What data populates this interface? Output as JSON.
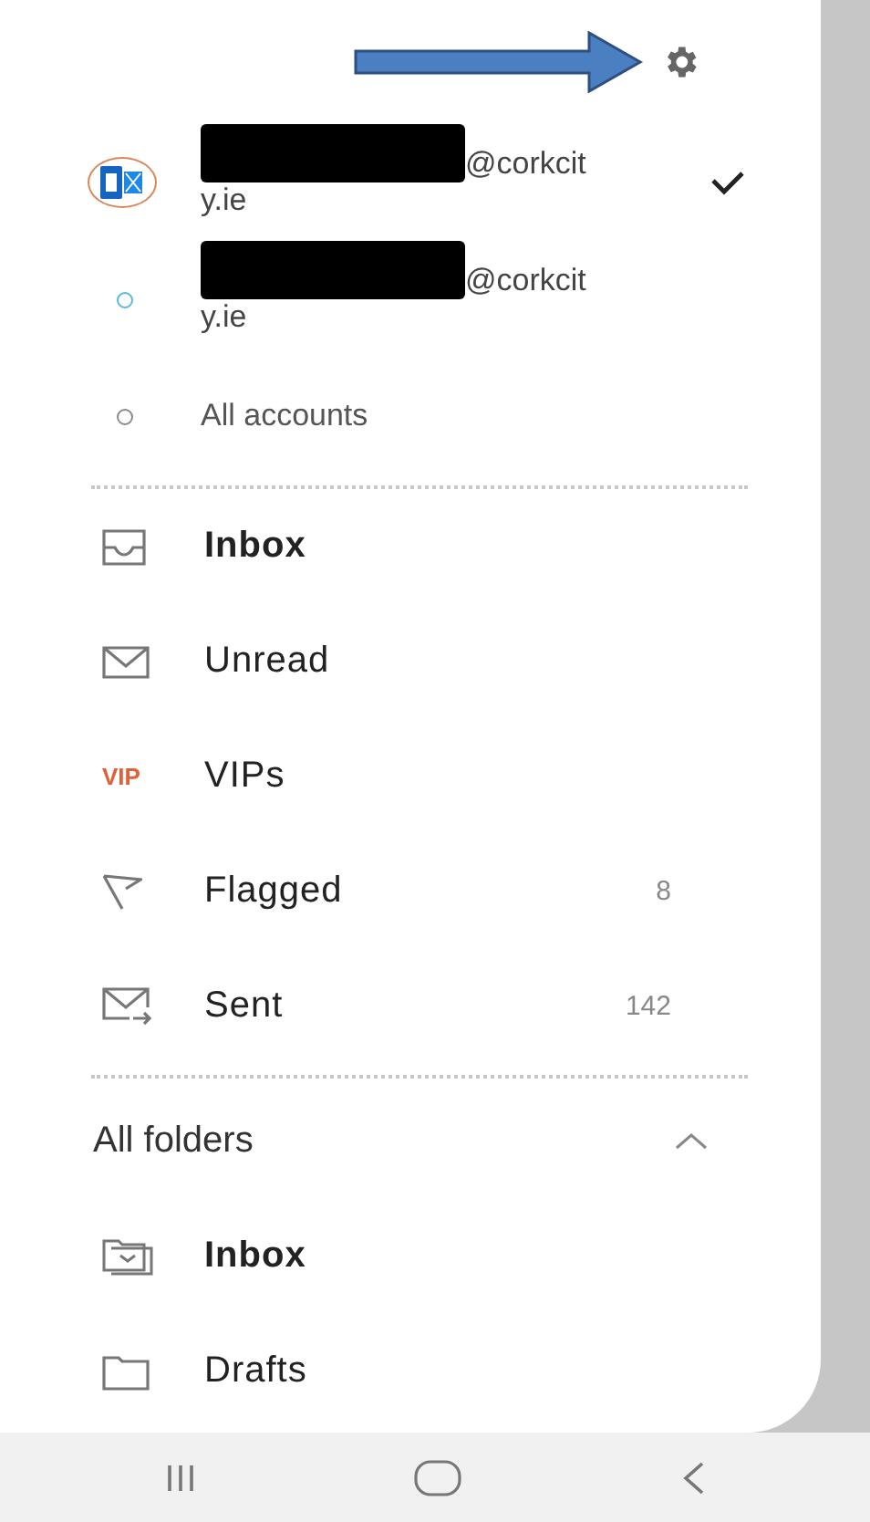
{
  "accounts": [
    {
      "kind": "exchange",
      "email": "@corkcity.ie",
      "redacted": true,
      "selected": true
    },
    {
      "kind": "dot",
      "color": "#5bb8d6",
      "email": "@corkcity.ie",
      "redacted": true,
      "selected": false
    },
    {
      "kind": "dot",
      "color": "#8a8a8a",
      "label": "All accounts",
      "selected": false
    }
  ],
  "favorites": [
    {
      "kind": "inbox",
      "label": "Inbox",
      "bold": true
    },
    {
      "kind": "unread",
      "label": "Unread",
      "bold": false
    },
    {
      "kind": "vip",
      "icon_text": "VIP",
      "label": "VIPs",
      "bold": false
    },
    {
      "kind": "flag",
      "label": "Flagged",
      "bold": false,
      "count": "8"
    },
    {
      "kind": "sent",
      "label": "Sent",
      "bold": false,
      "count": "142"
    }
  ],
  "all_folders": {
    "title": "All folders",
    "expanded": true,
    "items": [
      {
        "kind": "folder-inbox",
        "label": "Inbox",
        "bold": true
      },
      {
        "kind": "folder",
        "label": "Drafts",
        "bold": false
      }
    ]
  }
}
